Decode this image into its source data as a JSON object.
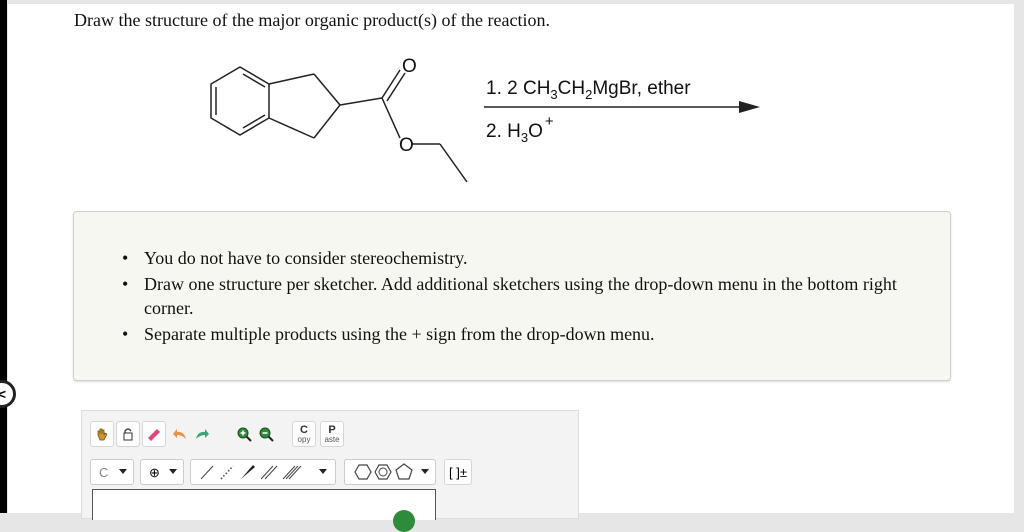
{
  "question": "Draw the structure of the major organic product(s) of the reaction.",
  "reaction": {
    "step1": {
      "prefix": "1.  2 CH",
      "s1": "3",
      "mid": "CH",
      "s2": "2",
      "suffix": "MgBr, ether"
    },
    "step2": {
      "prefix": "2. H",
      "s1": "3",
      "mid": "O",
      "sup": "+"
    },
    "atoms": {
      "carbonyl_o": "O",
      "ester_o": "O"
    }
  },
  "notes": [
    "You do not have to consider stereochemistry.",
    "Draw one structure per sketcher. Add additional sketchers using the drop-down menu in the bottom right corner.",
    "Separate multiple products using the + sign from the drop-down menu."
  ],
  "back_tab": "<",
  "toolbar": {
    "copy": {
      "big": "C",
      "small": "opy"
    },
    "paste": {
      "big": "P",
      "small": "aste"
    },
    "atom_select": "C",
    "charge_select": "⊕",
    "bracket_label": "[ ]±"
  },
  "colors": {
    "accent_green": "#2e8b3a",
    "eraser_pink": "#e0457b",
    "undo_orange": "#e8934a",
    "redo_teal": "#3aa57a"
  }
}
